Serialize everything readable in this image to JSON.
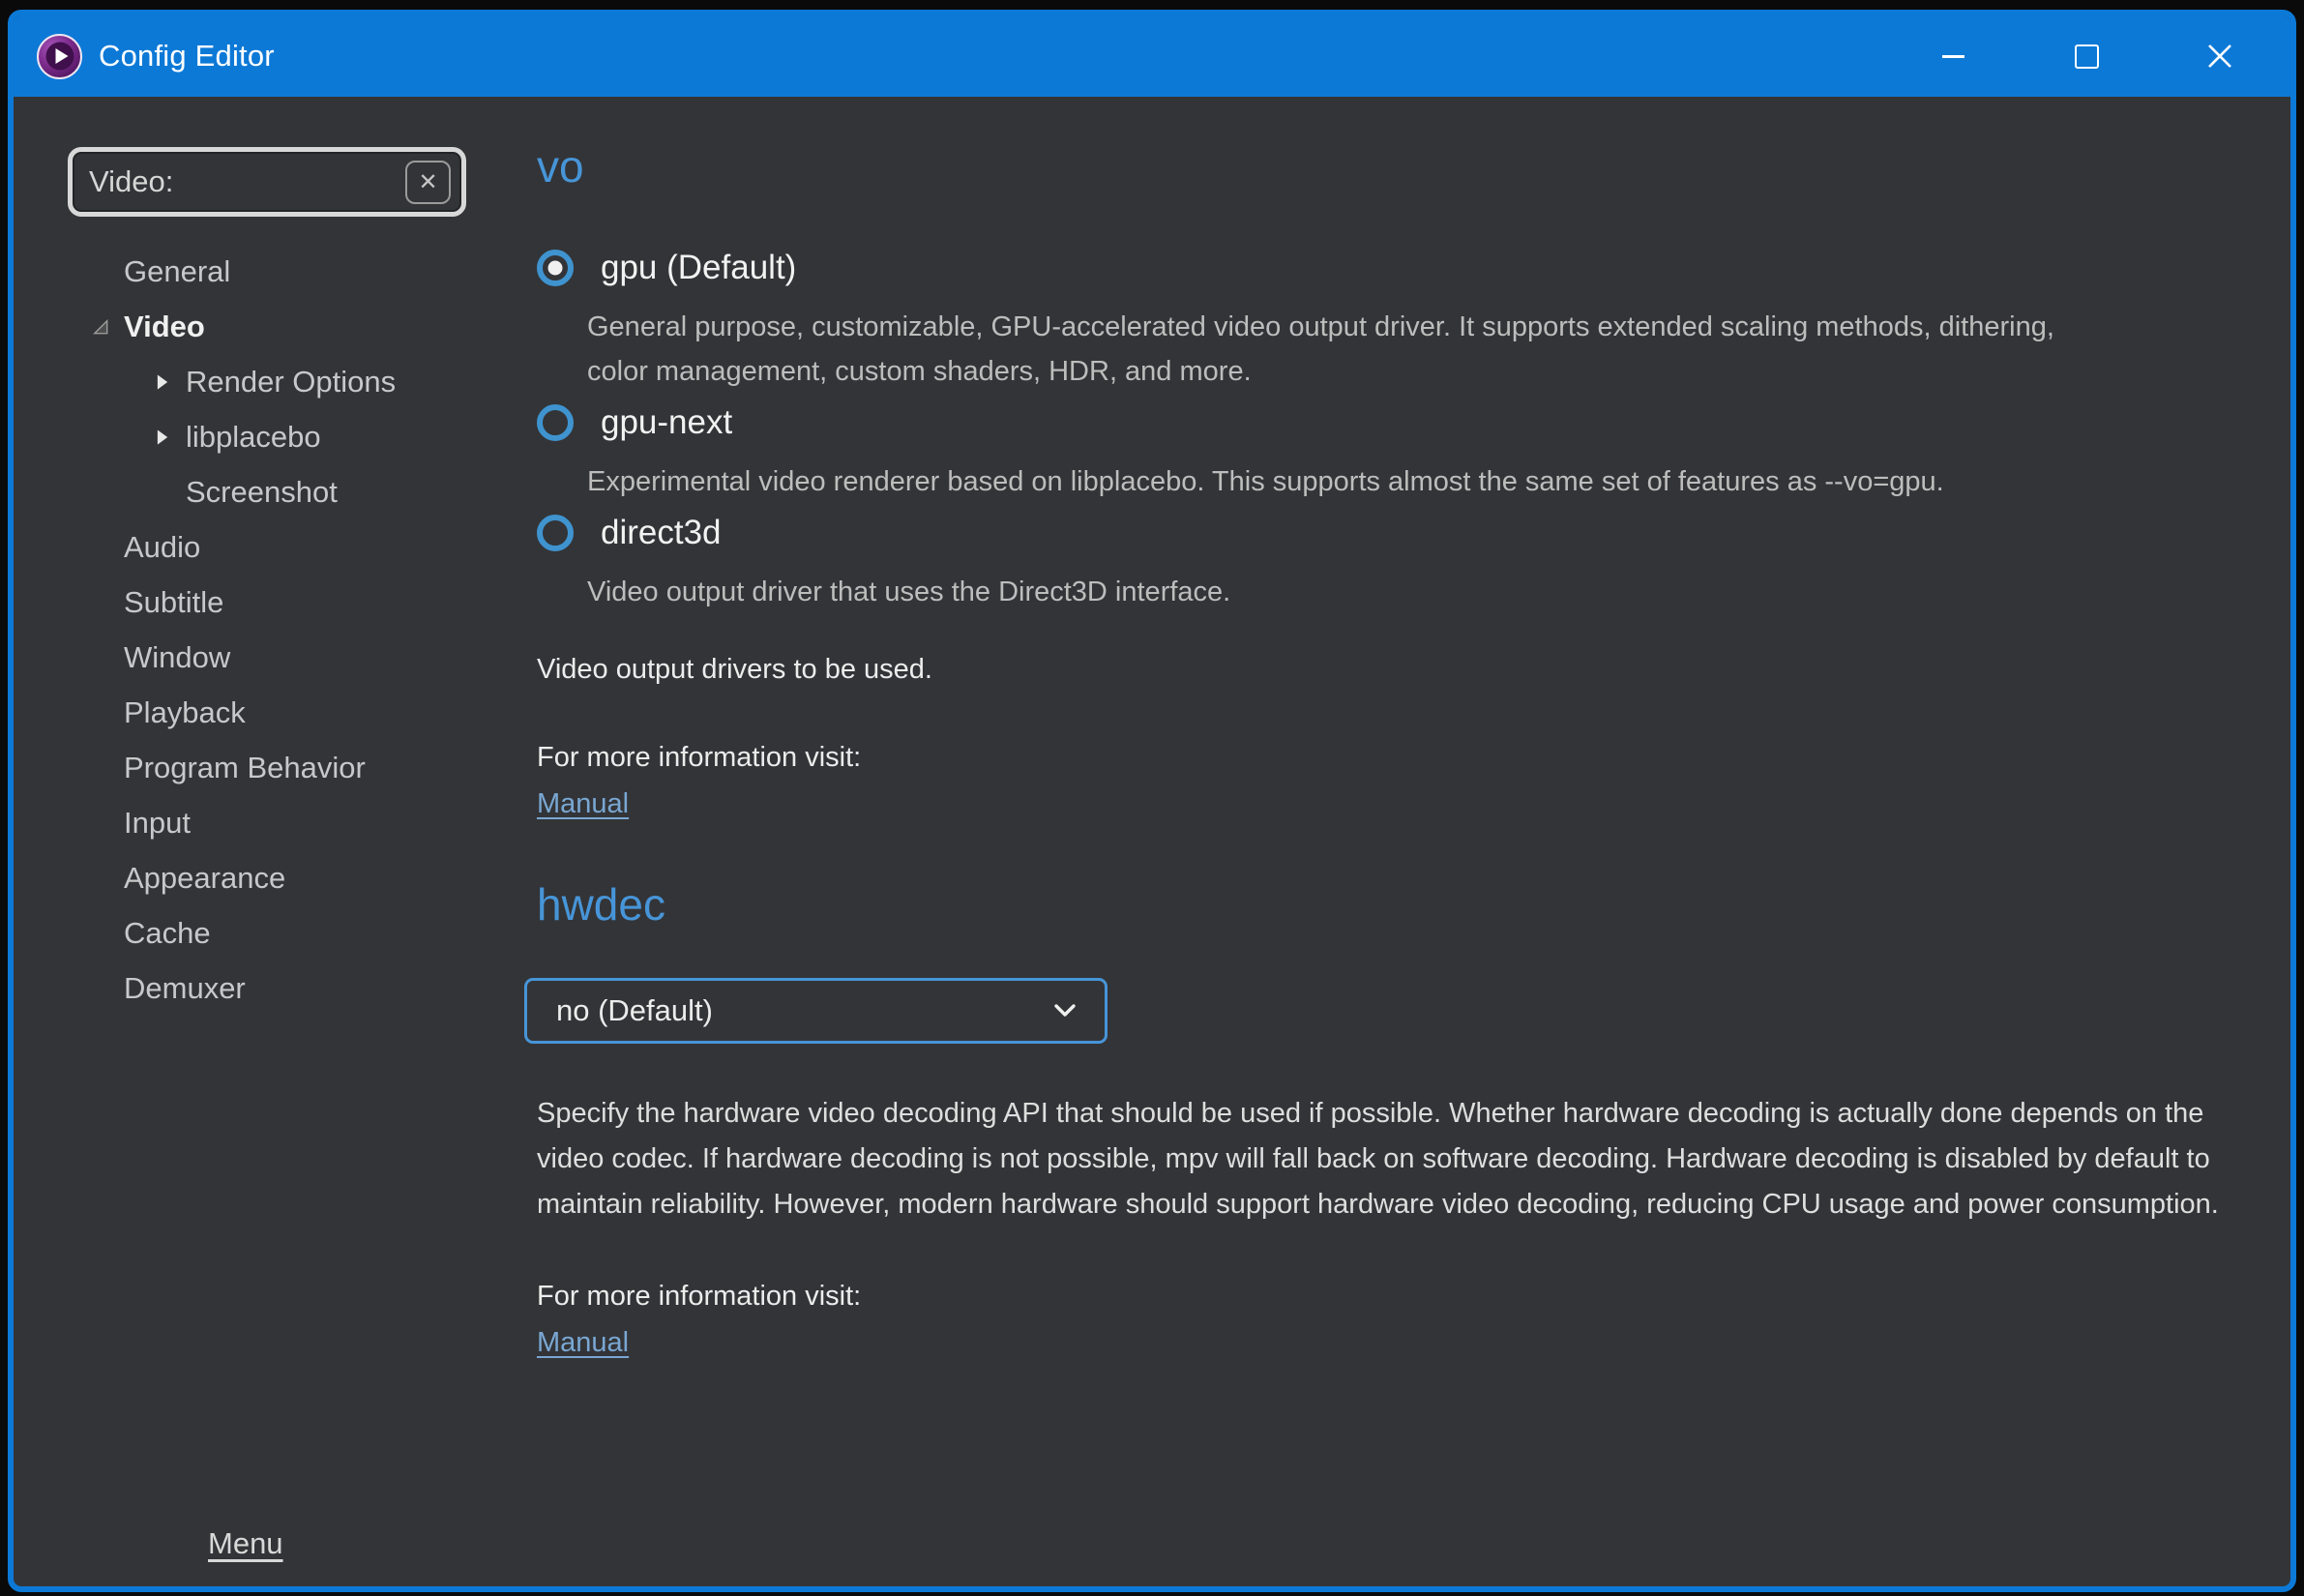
{
  "window": {
    "title": "Config Editor"
  },
  "icons": {
    "clear": "✕"
  },
  "colors": {
    "titlebar": "#0c79d7",
    "background": "#333437",
    "accent_heading": "#4795d8",
    "radio_ring": "#3f93cf",
    "link": "#79a7d3"
  },
  "sidebar": {
    "search": {
      "value": "Video:"
    },
    "tree": [
      {
        "label": "General"
      },
      {
        "label": "Video"
      },
      {
        "label": "Render Options"
      },
      {
        "label": "libplacebo"
      },
      {
        "label": "Screenshot"
      },
      {
        "label": "Audio"
      },
      {
        "label": "Subtitle"
      },
      {
        "label": "Window"
      },
      {
        "label": "Playback"
      },
      {
        "label": "Program Behavior"
      },
      {
        "label": "Input"
      },
      {
        "label": "Appearance"
      },
      {
        "label": "Cache"
      },
      {
        "label": "Demuxer"
      }
    ],
    "menu_link": "Menu"
  },
  "vo": {
    "heading": "vo",
    "options": [
      {
        "label": "gpu (Default)",
        "selected": true,
        "description": "General purpose, customizable, GPU-accelerated video output driver. It supports extended scaling methods, dithering, color management, custom shaders, HDR, and more."
      },
      {
        "label": "gpu-next",
        "selected": false,
        "description": "Experimental video renderer based on libplacebo. This supports almost the same set of features as --vo=gpu."
      },
      {
        "label": "direct3d",
        "selected": false,
        "description": "Video output driver that uses the Direct3D interface."
      }
    ],
    "summary": "Video output drivers to be used.",
    "info_label": "For more information visit:",
    "link_label": "Manual"
  },
  "hwdec": {
    "heading": "hwdec",
    "dropdown_value": "no (Default)",
    "description": "Specify the hardware video decoding API that should be used if possible. Whether hardware decoding is actually done depends on the video codec. If hardware decoding is not possible, mpv will fall back on software decoding. Hardware decoding is disabled by default to maintain reliability. However, modern hardware should support hardware video decoding, reducing CPU usage and power consumption.",
    "info_label": "For more information visit:",
    "link_label": "Manual"
  }
}
